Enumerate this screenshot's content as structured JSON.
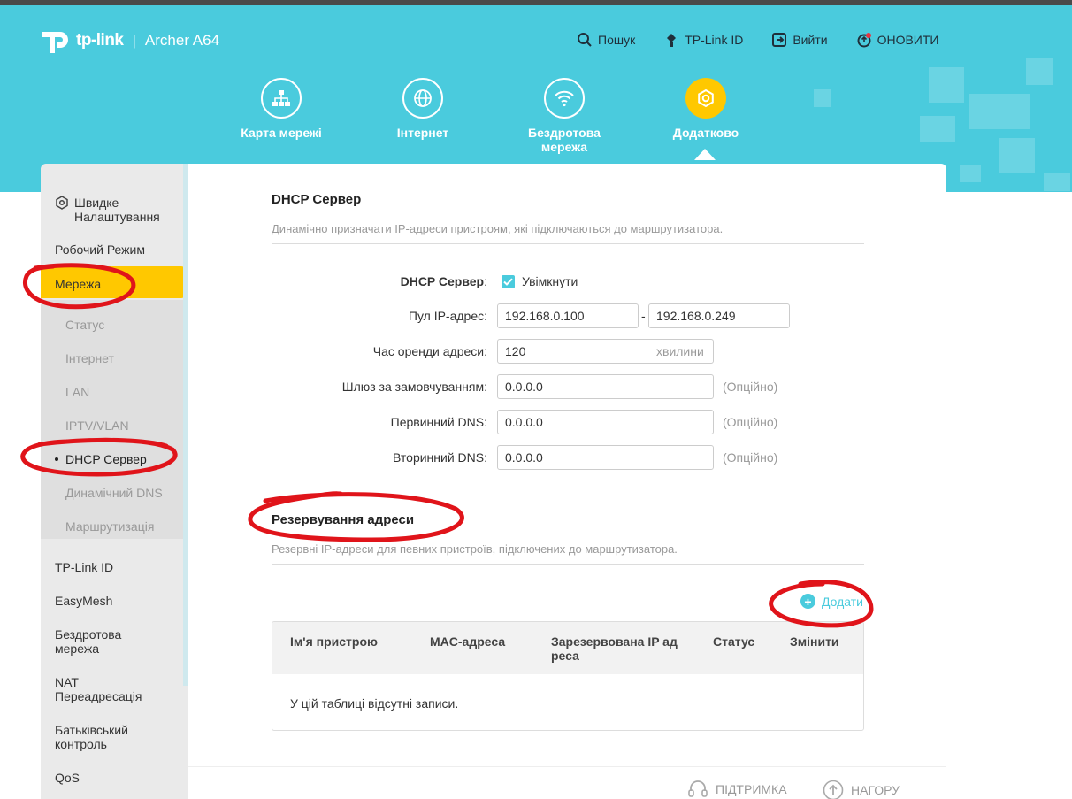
{
  "header": {
    "brand": "tp-link",
    "separator": "|",
    "model": "Archer A64",
    "actions": [
      {
        "label": "Пошук",
        "icon": "search-icon"
      },
      {
        "label": "TP-Link ID",
        "icon": "tplink-id-icon"
      },
      {
        "label": "Вийти",
        "icon": "logout-icon"
      },
      {
        "label": "ОНОВИТИ",
        "icon": "update-icon"
      }
    ],
    "accent_color": "#4acbdd",
    "active_color": "#ffc800"
  },
  "nav": {
    "tabs": [
      {
        "label": "Карта мережі",
        "icon": "network-map-icon"
      },
      {
        "label": "Інтернет",
        "icon": "globe-icon"
      },
      {
        "label": "Бездротова мережа",
        "icon": "wifi-icon"
      },
      {
        "label": "Додатково",
        "icon": "advanced-gear-icon",
        "active": true
      }
    ]
  },
  "sidebar": {
    "items": [
      {
        "label": "Швидке Налаштування",
        "icon": "quick-setup-icon"
      },
      {
        "label": "Робочий Режим"
      },
      {
        "label": "Мережа",
        "active": true
      },
      {
        "label": "TP-Link ID"
      },
      {
        "label": "EasyMesh"
      },
      {
        "label": "Бездротова мережа"
      },
      {
        "label": "NAT Переадресація"
      },
      {
        "label": "Батьківський контроль"
      },
      {
        "label": "QoS"
      }
    ],
    "subitems": [
      {
        "label": "Статус"
      },
      {
        "label": "Інтернет"
      },
      {
        "label": "LAN"
      },
      {
        "label": "IPTV/VLAN"
      },
      {
        "label": "DHCP Сервер",
        "active": true
      },
      {
        "label": "Динамічний DNS"
      },
      {
        "label": "Маршрутизація"
      }
    ]
  },
  "dhcp": {
    "title": "DHCP Сервер",
    "desc": "Динамічно призначати IP-адреси пристроям, які підключаються до маршрутизатора.",
    "server_label": "DHCP Сервер",
    "server_colon": ":",
    "enable_label": "Увімкнути",
    "enabled": true,
    "pool_label": "Пул IP-адрес:",
    "pool_start": "192.168.0.100",
    "pool_dash": "-",
    "pool_end": "192.168.0.249",
    "lease_label": "Час оренди адреси:",
    "lease_value": "120",
    "lease_unit": "хвилини",
    "gateway_label": "Шлюз за замовчуванням:",
    "gateway_value": "0.0.0.0",
    "dns1_label": "Первинний DNS:",
    "dns1_value": "0.0.0.0",
    "dns2_label": "Вторинний DNS:",
    "dns2_value": "0.0.0.0",
    "optional": "(Опційно)"
  },
  "reservation": {
    "title": "Резервування адреси",
    "desc": "Резервні IP-адреси для певних пристроїв, підключених до маршрутизатора.",
    "add_label": "Додати",
    "columns": [
      "Ім'я пристрою",
      "MAC-адреса",
      "Зарезервована IP ад реса",
      "Статус",
      "Змінити"
    ],
    "empty": "У цій таблиці відсутні записи."
  },
  "footer": {
    "support": "ПІДТРИМКА",
    "top": "НАГОРУ"
  }
}
